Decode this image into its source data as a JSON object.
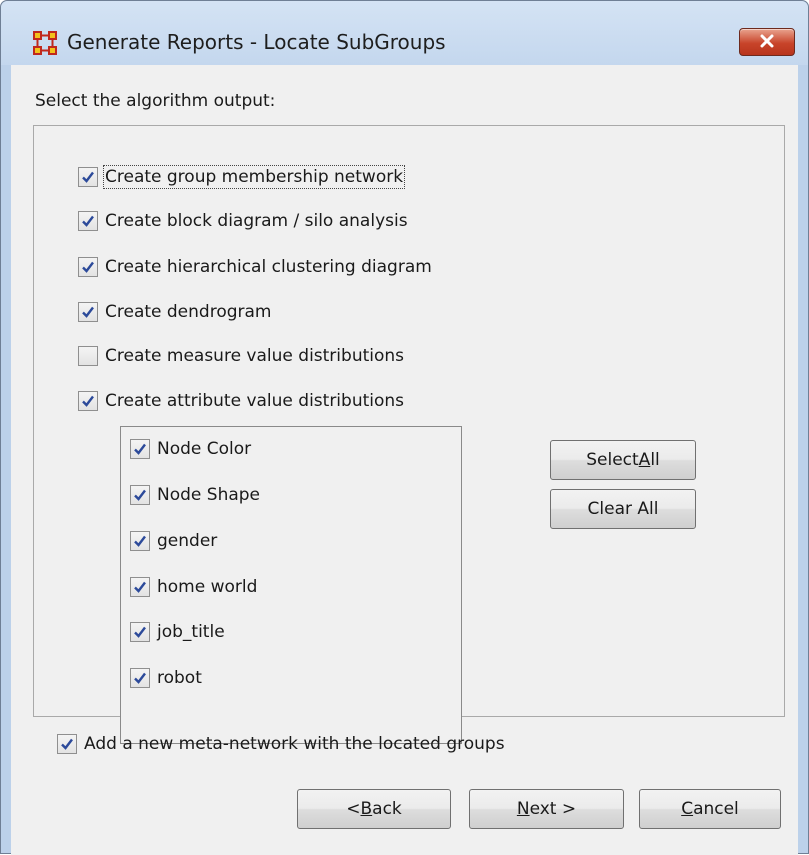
{
  "window": {
    "title": "Generate Reports - Locate SubGroups",
    "icon": "network-grid-icon",
    "close_icon": "close-icon"
  },
  "prompt": "Select the algorithm output:",
  "options": [
    {
      "label": "Create group membership network",
      "checked": true
    },
    {
      "label": "Create block diagram / silo analysis",
      "checked": true
    },
    {
      "label": "Create hierarchical clustering diagram",
      "checked": true
    },
    {
      "label": "Create dendrogram",
      "checked": true
    },
    {
      "label": "Create measure value distributions",
      "checked": false
    },
    {
      "label": "Create attribute value distributions",
      "checked": true
    }
  ],
  "attributes": [
    {
      "label": "Node Color",
      "checked": true
    },
    {
      "label": "Node Shape",
      "checked": true
    },
    {
      "label": "gender",
      "checked": true
    },
    {
      "label": "home world",
      "checked": true
    },
    {
      "label": "job_title",
      "checked": true
    },
    {
      "label": "robot",
      "checked": true
    }
  ],
  "select_all": {
    "pre": "Select ",
    "mn": "A",
    "post": "ll"
  },
  "clear_all": {
    "label": "Clear All"
  },
  "meta_network": {
    "label": "Add a new meta-network with the located groups",
    "checked": true
  },
  "back": {
    "pre": "< ",
    "mn": "B",
    "post": "ack"
  },
  "next": {
    "pre": "",
    "mn": "N",
    "post": "ext >"
  },
  "cancel": {
    "pre": "",
    "mn": "C",
    "post": "ancel"
  },
  "colors": {
    "check": "#2c4a9a",
    "close_bg": "#c8442a"
  }
}
